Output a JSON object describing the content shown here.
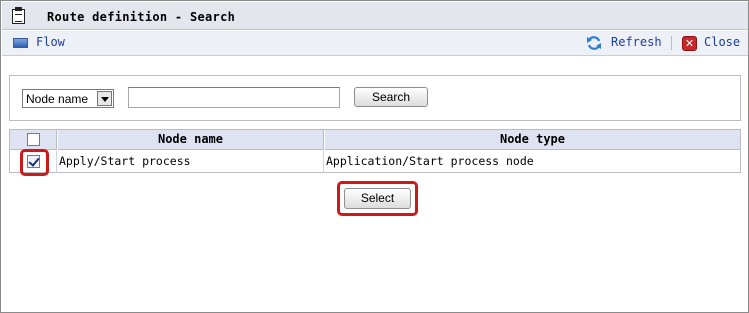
{
  "window": {
    "title": "Route definition - Search"
  },
  "toolbar": {
    "flow_label": "Flow",
    "refresh_label": "Refresh",
    "close_label": "Close"
  },
  "search": {
    "field_select_value": "Node name",
    "input_value": "",
    "search_button_label": "Search"
  },
  "table": {
    "headers": [
      "",
      "Node name",
      "Node type"
    ],
    "rows": [
      {
        "checked": true,
        "node_name": "Apply/Start process",
        "node_type": "Application/Start process node"
      }
    ]
  },
  "actions": {
    "select_button_label": "Select"
  },
  "colors": {
    "title_bar_bg": "#e4e6ee",
    "toolbar_bg": "#eef0f7",
    "link": "#1a3fa0",
    "header_bg": "#dfe2f1",
    "highlight": "#cc1a1a"
  },
  "icons": {
    "title": "clipboard-icon",
    "flow": "flow-icon",
    "refresh": "refresh-icon",
    "close": "close-icon"
  }
}
